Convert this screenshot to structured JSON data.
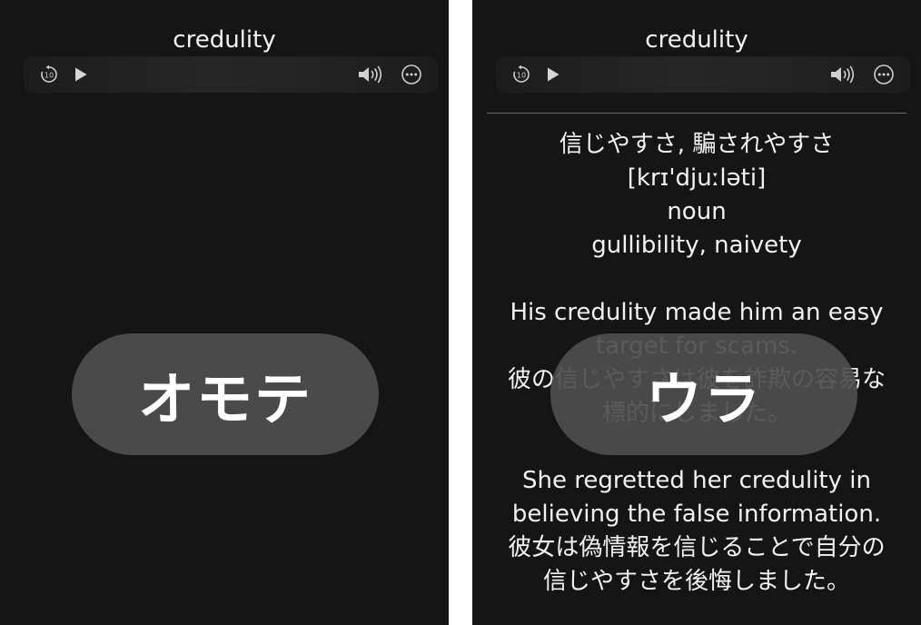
{
  "front": {
    "title": "credulity",
    "flip_label": "オモテ"
  },
  "back": {
    "title": "credulity",
    "flip_label": "ウラ",
    "meaning": "信じやすさ, 騙されやすさ",
    "pronunciation": "[krɪ'djuːləti]",
    "part_of_speech": "noun",
    "synonyms": "gullibility, naivety",
    "example1": {
      "en_line1": "His credulity made him an easy",
      "en_line2": "target for scams.",
      "ja_line1": "彼の信じやすさは彼を詐欺の容易な",
      "ja_line2": "標的にしました。"
    },
    "example2": {
      "en_line1": "She regretted her credulity in",
      "en_line2": "believing the false information.",
      "ja_line1": "彼女は偽情報を信じることで自分の",
      "ja_line2": "信じやすさを後悔しました。"
    }
  },
  "player": {
    "replay_icon": "replay-10-icon",
    "replay_value": "10",
    "play_icon": "play-icon",
    "volume_icon": "speaker-volume-icon",
    "more_icon": "more-ellipsis-icon"
  },
  "colors": {
    "background": "#151515",
    "text": "#f2f2f2",
    "pill": "#4e4e4e",
    "icon": "#cfcfcf"
  }
}
